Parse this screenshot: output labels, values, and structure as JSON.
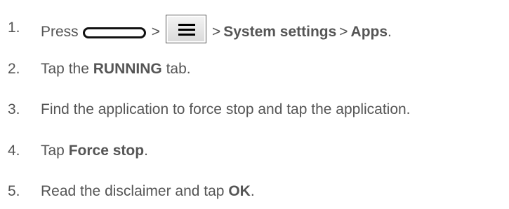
{
  "steps": [
    {
      "number": "1.",
      "press": "Press",
      "sep": ">",
      "item1": "System settings",
      "item2": "Apps",
      "end": "."
    },
    {
      "number": "2.",
      "before": "Tap the",
      "bold": "RUNNING",
      "after": "tab."
    },
    {
      "number": "3.",
      "text": "Find the application to force stop and tap the application."
    },
    {
      "number": "4.",
      "before": "Tap",
      "bold": "Force stop",
      "after": "."
    },
    {
      "number": "5.",
      "before": "Read the disclaimer and tap",
      "bold": "OK",
      "after": "."
    }
  ],
  "icons": {
    "home": "home-button-icon",
    "menu": "menu-button-icon"
  }
}
